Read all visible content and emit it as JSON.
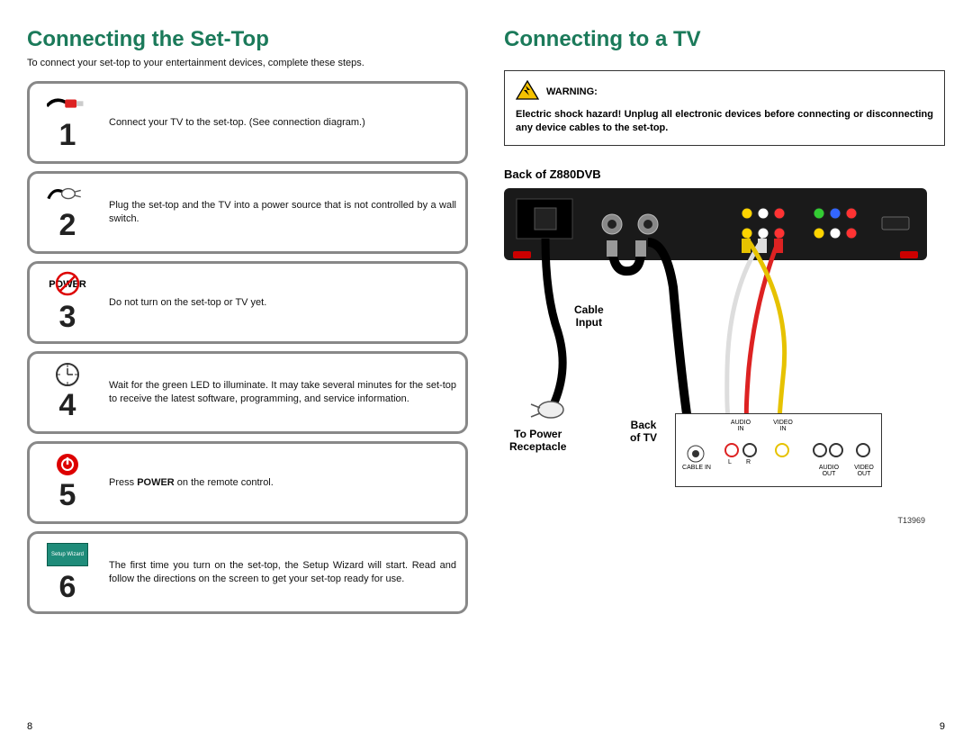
{
  "left": {
    "title": "Connecting the Set-Top",
    "intro": "To connect your set-top to your entertainment devices, complete these steps.",
    "steps": [
      {
        "num": "1",
        "text": "Connect your TV to the set-top. (See connection diagram.)"
      },
      {
        "num": "2",
        "text": "Plug the set-top and the TV into a power source that is not controlled by a wall switch."
      },
      {
        "num": "3",
        "text": "Do not turn on the set-top or TV yet."
      },
      {
        "num": "4",
        "text": "Wait for the green LED to illuminate. It may take several minutes for the set-top to receive the latest software, programming, and service information."
      },
      {
        "num": "5",
        "text_pre": "Press ",
        "text_bold": "POWER",
        "text_post": " on the remote control."
      },
      {
        "num": "6",
        "text": "The first time you turn on the set-top, the Setup Wizard will start. Read and follow the directions on the screen to get your set-top ready for use."
      }
    ],
    "page": "8",
    "icon3_label": "POWER",
    "icon6_label": "Setup Wizard"
  },
  "right": {
    "title": "Connecting to a TV",
    "warning_label": "WARNING:",
    "warning_body": "Electric shock hazard! Unplug all electronic devices before connecting or disconnecting any device cables to the set-top.",
    "subhead": "Back of Z880DVB",
    "labels": {
      "cable_input": "Cable\nInput",
      "to_power": "To Power\nReceptacle",
      "back_of_tv": "Back\nof TV",
      "audio_in": "AUDIO\nIN",
      "video_in": "VIDEO\nIN",
      "cable_in": "CABLE IN",
      "audio_out": "AUDIO\nOUT",
      "video_out": "VIDEO\nOUT",
      "l": "L",
      "r": "R"
    },
    "diagram_code": "T13969",
    "page": "9"
  }
}
